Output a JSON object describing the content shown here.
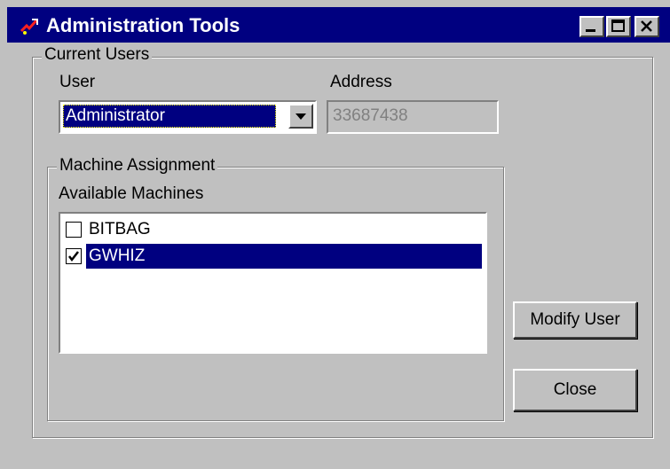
{
  "window": {
    "title": "Administration Tools",
    "title_bar_color": "#000080",
    "controls": [
      "minimize-icon",
      "maximize-icon",
      "close-icon"
    ]
  },
  "current_users": {
    "legend": "Current Users",
    "user_label": "User",
    "user_selected": "Administrator",
    "address_label": "Address",
    "address_value": "33687438"
  },
  "machine_assignment": {
    "legend": "Machine Assignment",
    "list_label": "Available Machines",
    "machines": [
      {
        "name": "BITBAG",
        "checked": false,
        "selected": false
      },
      {
        "name": "GWHIZ",
        "checked": true,
        "selected": true
      }
    ]
  },
  "buttons": {
    "modify_user": "Modify User",
    "close": "Close"
  }
}
